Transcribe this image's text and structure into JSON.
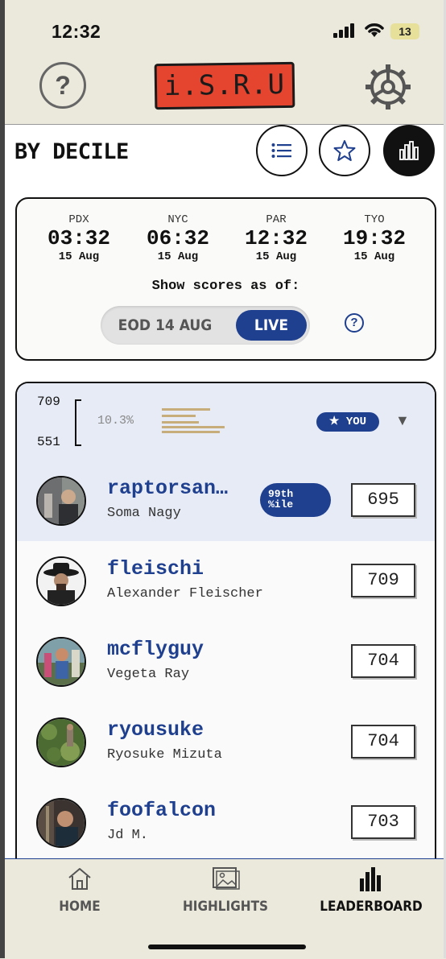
{
  "status_bar": {
    "time": "12:32",
    "battery": "13"
  },
  "header": {
    "help_symbol": "?",
    "logo_text": "i.S.R.U",
    "accent_color": "#e5452e"
  },
  "title_row": {
    "title": "BY DECILE",
    "view_buttons": [
      "list-icon",
      "star-icon",
      "bar-chart-icon"
    ]
  },
  "time_card": {
    "zones": [
      {
        "code": "PDX",
        "time": "03:32",
        "date": "15 Aug"
      },
      {
        "code": "NYC",
        "time": "06:32",
        "date": "15 Aug"
      },
      {
        "code": "PAR",
        "time": "12:32",
        "date": "15 Aug"
      },
      {
        "code": "TYO",
        "time": "19:32",
        "date": "15 Aug"
      }
    ],
    "show_scores_label": "Show scores as of:",
    "toggle_options": {
      "eod": "EOD 14 AUG",
      "live": "LIVE"
    },
    "selected": "LIVE",
    "help_symbol": "?"
  },
  "decile": {
    "range_high": "709",
    "range_low": "551",
    "percent": "10.3%",
    "you_badge": "★ YOU",
    "caret": "▼"
  },
  "rows": [
    {
      "username": "raptorsan…",
      "realname": "Soma Nagy",
      "score": "695",
      "badge_line1": "99th",
      "badge_line2": "%ile",
      "highlight": true
    },
    {
      "username": "fleischi",
      "realname": "Alexander Fleischer",
      "score": "709"
    },
    {
      "username": "mcflyguy",
      "realname": "Vegeta Ray",
      "score": "704"
    },
    {
      "username": "ryousuke",
      "realname": "Ryosuke Mizuta",
      "score": "704"
    },
    {
      "username": "foofalcon",
      "realname": "Jd M.",
      "score": "703"
    }
  ],
  "bottom_nav": {
    "home": "HOME",
    "highlights": "HIGHLIGHTS",
    "leaderboard": "LEADERBOARD",
    "active": "LEADERBOARD"
  },
  "colors": {
    "primary_blue": "#1f3f8f",
    "background": "#ebe8dc",
    "bar_tan": "#c6ad7a"
  }
}
